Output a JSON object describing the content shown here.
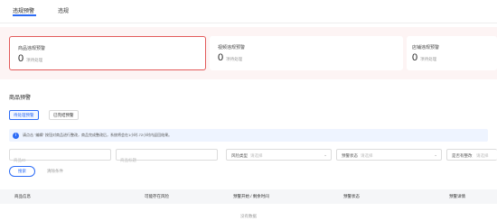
{
  "tabs": [
    {
      "label": "违规预警",
      "active": true
    },
    {
      "label": "违规",
      "active": false
    }
  ],
  "stats": [
    {
      "title": "商品违规预警",
      "value": "0",
      "sub": "项待处理",
      "highlight": true
    },
    {
      "title": "视频违规预警",
      "value": "0",
      "sub": "项待处理",
      "highlight": false
    },
    {
      "title": "店铺违规预警",
      "value": "0",
      "sub": "项待处理",
      "highlight": false
    }
  ],
  "section": {
    "title": "商品预警"
  },
  "status_tabs": [
    {
      "label": "待处理预警",
      "active": true
    },
    {
      "label": "已完结预警",
      "active": false
    }
  ],
  "notice": {
    "text": "请点击 \"编辑\" 按钮对商品进行整改，商品完成整改后，系统将会在1小时-72小时内返回结果。"
  },
  "filters": {
    "product_id_placeholder": "商品ID",
    "product_title_placeholder": "商品标题",
    "risk_type": {
      "label": "风险类型",
      "placeholder": "请选择"
    },
    "warning_status": {
      "label": "预警状态",
      "placeholder": "请选择"
    },
    "rectified": {
      "label": "是否有整改",
      "placeholder": "请选择"
    }
  },
  "actions": {
    "search": "搜索",
    "clear": "清除条件"
  },
  "table": {
    "headers": [
      "商品信息",
      "可能存在风险",
      "预警开始 / 剩余时间",
      "预警状态",
      "预警详情"
    ],
    "empty": "没有数据"
  },
  "colors": {
    "accent": "#2d6cf6",
    "alert_border": "#e35a5a",
    "band": "#fdf4f4"
  }
}
